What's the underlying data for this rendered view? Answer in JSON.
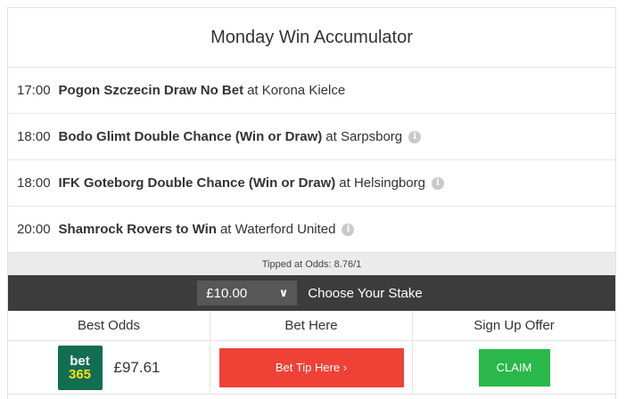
{
  "title": "Monday Win Accumulator",
  "tips": [
    {
      "time": "17:00",
      "selection": "Pogon Szczecin Draw No Bet",
      "at": "at",
      "opponent": "Korona Kielce",
      "info": false
    },
    {
      "time": "18:00",
      "selection": "Bodo Glimt Double Chance (Win or Draw)",
      "at": "at",
      "opponent": "Sarpsborg",
      "info": true
    },
    {
      "time": "18:00",
      "selection": "IFK Goteborg Double Chance (Win or Draw)",
      "at": "at",
      "opponent": "Helsingborg",
      "info": true
    },
    {
      "time": "20:00",
      "selection": "Shamrock Rovers to Win",
      "at": "at",
      "opponent": "Waterford United",
      "info": true
    }
  ],
  "odds_text": "Tipped at Odds: 8.76/1",
  "stake": {
    "selected": "£10.00",
    "label": "Choose Your Stake"
  },
  "table": {
    "headers": [
      "Best Odds",
      "Bet Here",
      "Sign Up Offer"
    ],
    "row": {
      "logo_top": "bet",
      "logo_bottom": "365",
      "return": "£97.61",
      "bet_label": "Bet Tip Here ›",
      "claim_label": "CLAIM"
    }
  },
  "colors": {
    "bet_button": "#ef4136",
    "claim_button": "#2ab84a",
    "stake_bar": "#3c3c3c",
    "logo_bg": "#126e51",
    "logo_accent": "#ffdf1b"
  }
}
